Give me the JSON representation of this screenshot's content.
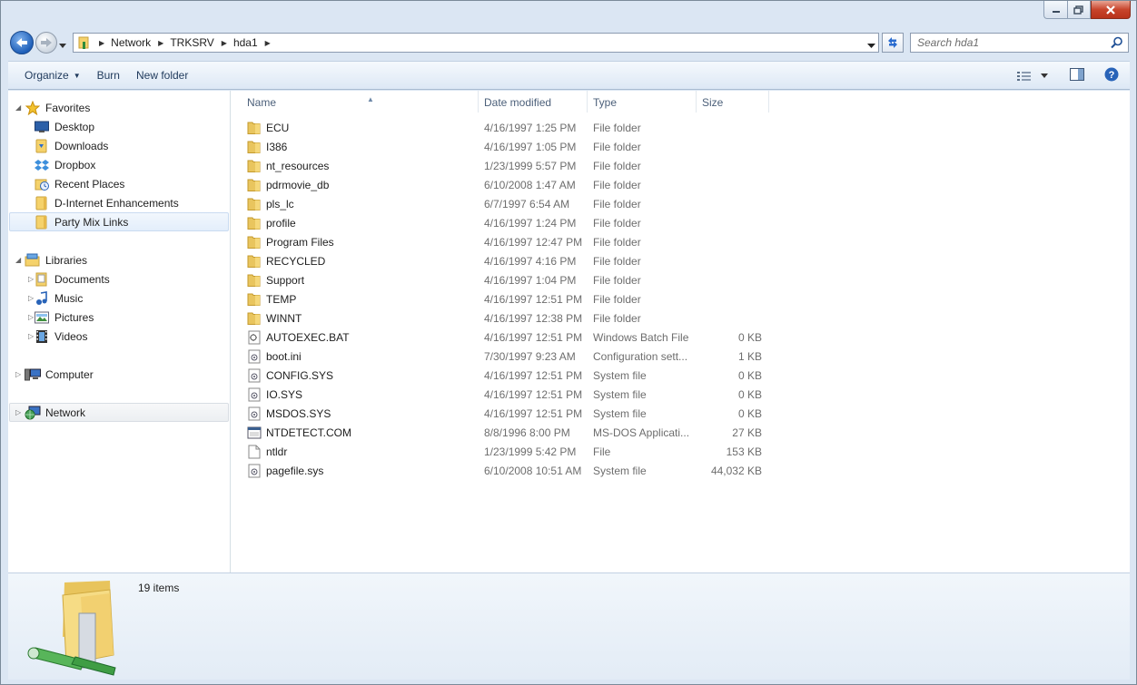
{
  "window": {
    "caption_buttons": [
      "minimize-icon",
      "maximize-icon",
      "close-icon"
    ]
  },
  "address_bar": {
    "breadcrumbs": [
      "Network",
      "TRKSRV",
      "hda1"
    ]
  },
  "search": {
    "placeholder": "Search hda1"
  },
  "toolbar": {
    "organize_label": "Organize",
    "burn_label": "Burn",
    "new_folder_label": "New folder"
  },
  "nav_pane": {
    "favorites": {
      "label": "Favorites",
      "items": [
        {
          "label": "Desktop",
          "icon": "desktop-icon"
        },
        {
          "label": "Downloads",
          "icon": "downloads-folder-icon"
        },
        {
          "label": "Dropbox",
          "icon": "dropbox-icon"
        },
        {
          "label": "Recent Places",
          "icon": "recent-places-icon"
        },
        {
          "label": "D-Internet Enhancements",
          "icon": "folder-icon"
        },
        {
          "label": "Party Mix Links",
          "icon": "folder-icon"
        }
      ]
    },
    "libraries": {
      "label": "Libraries",
      "items": [
        {
          "label": "Documents",
          "icon": "documents-icon"
        },
        {
          "label": "Music",
          "icon": "music-icon"
        },
        {
          "label": "Pictures",
          "icon": "pictures-icon"
        },
        {
          "label": "Videos",
          "icon": "videos-icon"
        }
      ]
    },
    "computer": {
      "label": "Computer"
    },
    "network": {
      "label": "Network"
    }
  },
  "columns": {
    "name": "Name",
    "date": "Date modified",
    "type": "Type",
    "size": "Size"
  },
  "files": [
    {
      "name": "ECU",
      "date": "4/16/1997 1:25 PM",
      "type": "File folder",
      "size": "",
      "kind": "folder"
    },
    {
      "name": "I386",
      "date": "4/16/1997 1:05 PM",
      "type": "File folder",
      "size": "",
      "kind": "folder"
    },
    {
      "name": "nt_resources",
      "date": "1/23/1999 5:57 PM",
      "type": "File folder",
      "size": "",
      "kind": "folder"
    },
    {
      "name": "pdrmovie_db",
      "date": "6/10/2008 1:47 AM",
      "type": "File folder",
      "size": "",
      "kind": "folder"
    },
    {
      "name": "pls_lc",
      "date": "6/7/1997 6:54 AM",
      "type": "File folder",
      "size": "",
      "kind": "folder"
    },
    {
      "name": "profile",
      "date": "4/16/1997 1:24 PM",
      "type": "File folder",
      "size": "",
      "kind": "folder"
    },
    {
      "name": "Program Files",
      "date": "4/16/1997 12:47 PM",
      "type": "File folder",
      "size": "",
      "kind": "folder"
    },
    {
      "name": "RECYCLED",
      "date": "4/16/1997 4:16 PM",
      "type": "File folder",
      "size": "",
      "kind": "folder"
    },
    {
      "name": "Support",
      "date": "4/16/1997 1:04 PM",
      "type": "File folder",
      "size": "",
      "kind": "folder"
    },
    {
      "name": "TEMP",
      "date": "4/16/1997 12:51 PM",
      "type": "File folder",
      "size": "",
      "kind": "folder"
    },
    {
      "name": "WINNT",
      "date": "4/16/1997 12:38 PM",
      "type": "File folder",
      "size": "",
      "kind": "folder"
    },
    {
      "name": "AUTOEXEC.BAT",
      "date": "4/16/1997 12:51 PM",
      "type": "Windows Batch File",
      "size": "0 KB",
      "kind": "batch"
    },
    {
      "name": "boot.ini",
      "date": "7/30/1997 9:23 AM",
      "type": "Configuration sett...",
      "size": "1 KB",
      "kind": "config"
    },
    {
      "name": "CONFIG.SYS",
      "date": "4/16/1997 12:51 PM",
      "type": "System file",
      "size": "0 KB",
      "kind": "system"
    },
    {
      "name": "IO.SYS",
      "date": "4/16/1997 12:51 PM",
      "type": "System file",
      "size": "0 KB",
      "kind": "system"
    },
    {
      "name": "MSDOS.SYS",
      "date": "4/16/1997 12:51 PM",
      "type": "System file",
      "size": "0 KB",
      "kind": "system"
    },
    {
      "name": "NTDETECT.COM",
      "date": "8/8/1996 8:00 PM",
      "type": "MS-DOS Applicati...",
      "size": "27 KB",
      "kind": "app"
    },
    {
      "name": "ntldr",
      "date": "1/23/1999 5:42 PM",
      "type": "File",
      "size": "153 KB",
      "kind": "file"
    },
    {
      "name": "pagefile.sys",
      "date": "6/10/2008 10:51 AM",
      "type": "System file",
      "size": "44,032 KB",
      "kind": "system"
    }
  ],
  "details": {
    "count": "19 items"
  },
  "colors": {
    "folder": "#f5d26b",
    "accent": "#1f5fb8",
    "header_text": "#4c607a"
  }
}
